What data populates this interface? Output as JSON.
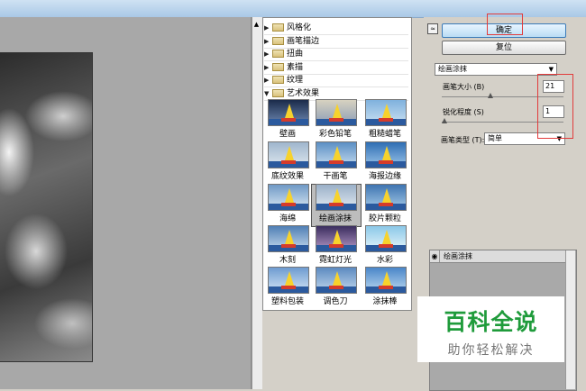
{
  "buttons": {
    "ok": "确定",
    "reset": "复位"
  },
  "categories": [
    {
      "label": "风格化",
      "expanded": false
    },
    {
      "label": "画笔描边",
      "expanded": false
    },
    {
      "label": "扭曲",
      "expanded": false
    },
    {
      "label": "素描",
      "expanded": false
    },
    {
      "label": "纹理",
      "expanded": false
    },
    {
      "label": "艺术效果",
      "expanded": true
    }
  ],
  "filters": [
    "壁画",
    "彩色铅笔",
    "粗糙蜡笔",
    "底纹效果",
    "干画笔",
    "海报边缘",
    "海绵",
    "绘画涂抹",
    "胶片颗粒",
    "木刻",
    "霓虹灯光",
    "水彩",
    "塑料包装",
    "调色刀",
    "涂抹棒"
  ],
  "selected_filter": "绘画涂抹",
  "settings": {
    "filter_select": "绘画涂抹",
    "brush_size_label": "画笔大小 (B)",
    "brush_size_value": "21",
    "sharpness_label": "锐化程度 (S)",
    "sharpness_value": "1",
    "brush_type_label": "画笔类型 (T):",
    "brush_type_value": "简单"
  },
  "layer": {
    "name": "绘画涂抹"
  },
  "watermark": {
    "title": "百科全说",
    "subtitle": "助你轻松解决"
  },
  "colors": {
    "accent_red": "#e23b3b",
    "watermark_green": "#1f9b3b"
  }
}
